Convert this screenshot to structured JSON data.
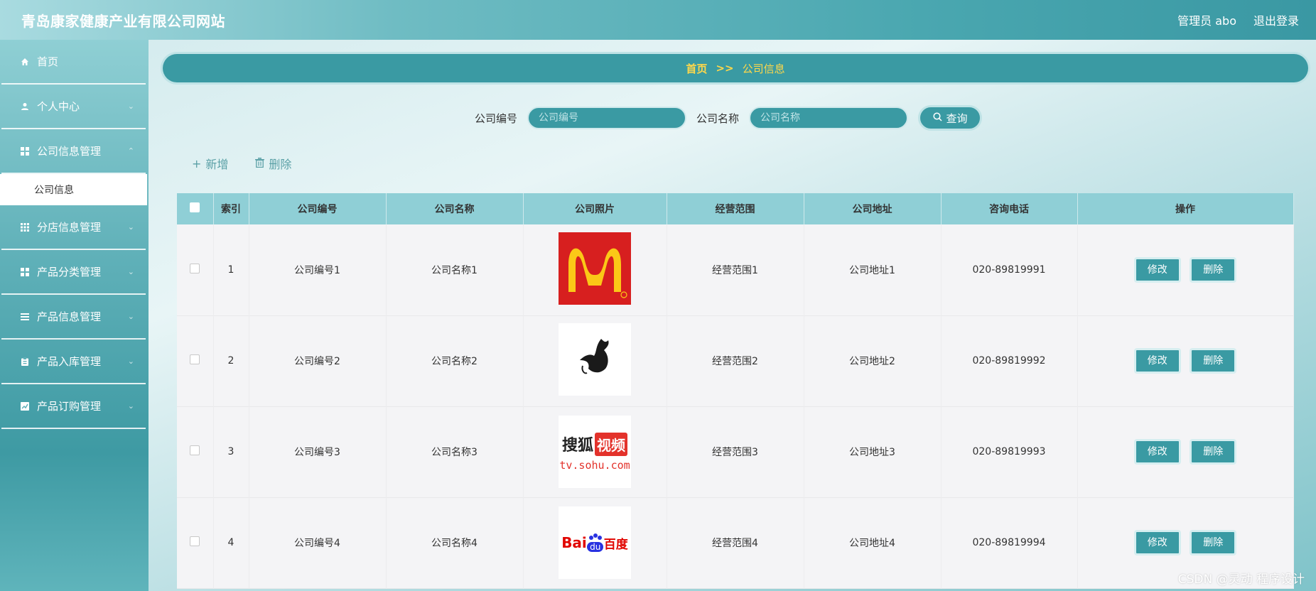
{
  "header": {
    "site_title": "青岛康家健康产业有限公司网站",
    "admin": "管理员 abo",
    "logout": "退出登录"
  },
  "sidebar": {
    "items": [
      {
        "label": "首页",
        "icon": "home-icon"
      },
      {
        "label": "个人中心",
        "icon": "user-icon"
      },
      {
        "label": "公司信息管理",
        "icon": "grid-icon",
        "sub": "公司信息"
      },
      {
        "label": "分店信息管理",
        "icon": "grid-icon"
      },
      {
        "label": "产品分类管理",
        "icon": "grid-icon"
      },
      {
        "label": "产品信息管理",
        "icon": "list-icon"
      },
      {
        "label": "产品入库管理",
        "icon": "clipboard-icon"
      },
      {
        "label": "产品订购管理",
        "icon": "chart-icon"
      }
    ]
  },
  "breadcrumb": {
    "home": "首页",
    "sep": ">>",
    "current": "公司信息"
  },
  "search": {
    "code_label": "公司编号",
    "code_placeholder": "公司编号",
    "name_label": "公司名称",
    "name_placeholder": "公司名称",
    "query": "查询"
  },
  "actions": {
    "add": "新增",
    "delete": "删除"
  },
  "table": {
    "headers": [
      "索引",
      "公司编号",
      "公司名称",
      "公司照片",
      "经营范围",
      "公司地址",
      "咨询电话",
      "操作"
    ],
    "edit_label": "修改",
    "delete_label": "删除",
    "rows": [
      {
        "idx": "1",
        "code": "公司编号1",
        "name": "公司名称1",
        "scope": "经营范围1",
        "addr": "公司地址1",
        "phone": "020-89819991",
        "logo": "mcdonalds-logo"
      },
      {
        "idx": "2",
        "code": "公司编号2",
        "name": "公司名称2",
        "scope": "经营范围2",
        "addr": "公司地址2",
        "phone": "020-89819992",
        "logo": "bird-logo"
      },
      {
        "idx": "3",
        "code": "公司编号3",
        "name": "公司名称3",
        "scope": "经营范围3",
        "addr": "公司地址3",
        "phone": "020-89819993",
        "logo": "sohu-logo",
        "logo_text": [
          "搜狐",
          "视频",
          "tv.sohu.com"
        ]
      },
      {
        "idx": "4",
        "code": "公司编号4",
        "name": "公司名称4",
        "scope": "经营范围4",
        "addr": "公司地址4",
        "phone": "020-89819994",
        "logo": "baidu-logo",
        "logo_text": [
          "Bai",
          "du",
          "百度"
        ]
      }
    ]
  },
  "watermark": "CSDN @灵动 程序设计",
  "colors": {
    "accent": "#3a9aa3",
    "breadcrumb_text": "#ffd84a",
    "header_row": "#8fcfd6"
  }
}
